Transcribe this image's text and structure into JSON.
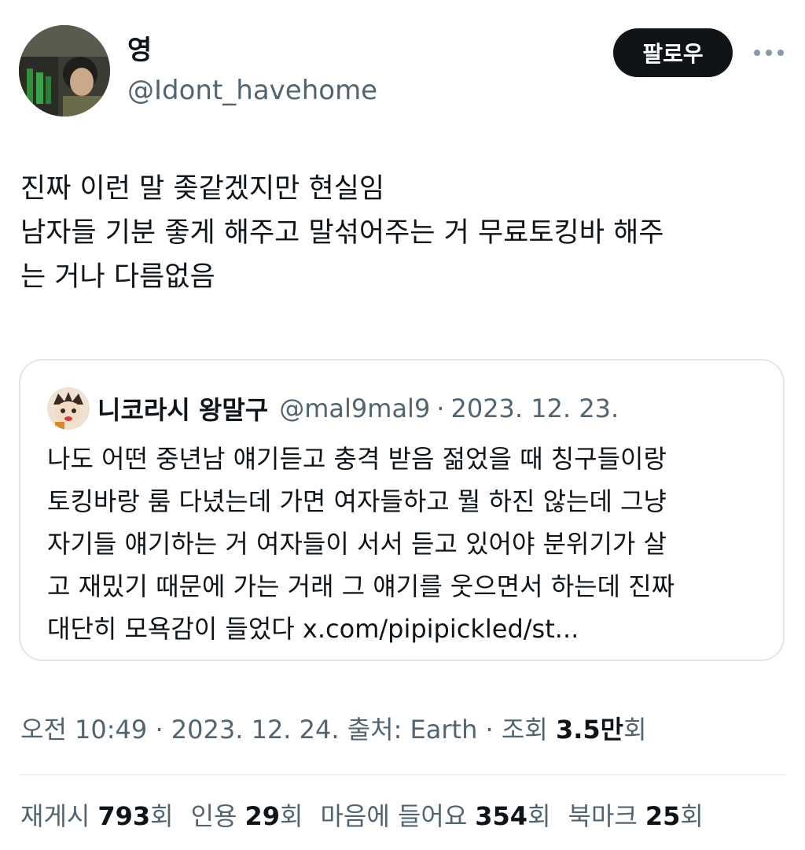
{
  "author": {
    "display_name": "영",
    "handle": "@Idont_havehome",
    "avatar_icon": "profile-photo"
  },
  "actions": {
    "follow_label": "팔로우",
    "more_icon": "more-horizontal-icon"
  },
  "tweet": {
    "lines": [
      "진짜 이런 말 좆같겠지만 현실임",
      "남자들 기분 좋게 해주고 말섞어주는 거 무료토킹바 해주",
      "는 거나 다름없음"
    ]
  },
  "quote": {
    "display_name": "니코라시 왕말구",
    "handle": "@mal9mal9",
    "separator": "·",
    "date": "2023. 12. 23.",
    "lines": [
      "나도 어떤 중년남 얘기듣고 충격 받음 젊었을 때 칭구들이랑",
      "토킹바랑 룸 다녔는데 가면 여자들하고 뭘 하진 않는데 그냥",
      "자기들 얘기하는 거 여자들이 서서 듣고 있어야 분위기가 살",
      "고 재밌기 때문에 가는 거래 그 얘기를 웃으면서 하는데 진짜",
      "대단히 모욕감이 들었다 x.com/pipipickled/st..."
    ]
  },
  "meta": {
    "time": "오전 10:49",
    "sep1": " · ",
    "date": "2023. 12. 24.",
    "source_label": " 출처: Earth",
    "sep2": " · ",
    "views_label": "조회 ",
    "views_count": "3.5만",
    "views_suffix": "회"
  },
  "stats": [
    {
      "label": "재게시",
      "count": "793",
      "suffix": "회"
    },
    {
      "label": "인용",
      "count": "29",
      "suffix": "회"
    },
    {
      "label": "마음에 들어요",
      "count": "354",
      "suffix": "회"
    },
    {
      "label": "북마크",
      "count": "25",
      "suffix": "회"
    }
  ],
  "colors": {
    "text_primary": "#0f1419",
    "text_secondary": "#536471",
    "border": "#e1e8ed",
    "button_bg": "#0f1419"
  }
}
